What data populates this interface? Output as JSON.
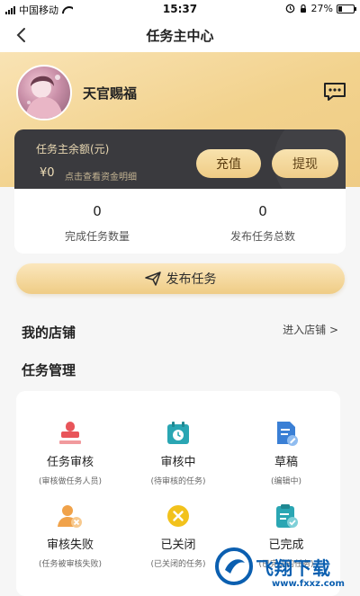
{
  "status_bar": {
    "carrier": "中国移动",
    "time": "15:37",
    "battery": "27%",
    "battery_level": 0.27
  },
  "nav": {
    "title": "任务主中心"
  },
  "user": {
    "name": "天官赐福"
  },
  "balance": {
    "label": "任务主余额(元)",
    "amount": "¥0",
    "detail_link": "点击查看资金明细",
    "recharge_label": "充值",
    "withdraw_label": "提现"
  },
  "stats": {
    "completed_count": "0",
    "completed_label": "完成任务数量",
    "published_count": "0",
    "published_label": "发布任务总数"
  },
  "publish_button": {
    "label": "发布任务"
  },
  "my_shop": {
    "title": "我的店铺",
    "enter_label": "进入店铺 >"
  },
  "task_management": {
    "title": "任务管理",
    "items": [
      {
        "label": "任务审核",
        "sub": "(审核做任务人员)",
        "icon": "stamp-icon",
        "color": "#e8555a"
      },
      {
        "label": "审核中",
        "sub": "(待审核的任务)",
        "icon": "calendar-clock-icon",
        "color": "#2aa6b3"
      },
      {
        "label": "草稿",
        "sub": "(编辑中)",
        "icon": "document-edit-icon",
        "color": "#3a7fd5"
      },
      {
        "label": "审核失败",
        "sub": "(任务被审核失败)",
        "icon": "user-reject-icon",
        "color": "#f0a24a"
      },
      {
        "label": "已关闭",
        "sub": "(已关闭的任务)",
        "icon": "close-circle-icon",
        "color": "#f2c21c"
      },
      {
        "label": "已完成",
        "sub": "(已完成的任务)",
        "icon": "clipboard-check-icon",
        "color": "#2aa6b3"
      }
    ]
  },
  "watermark": {
    "text": "飞翔下载",
    "sub": "www.fxxz.com"
  }
}
